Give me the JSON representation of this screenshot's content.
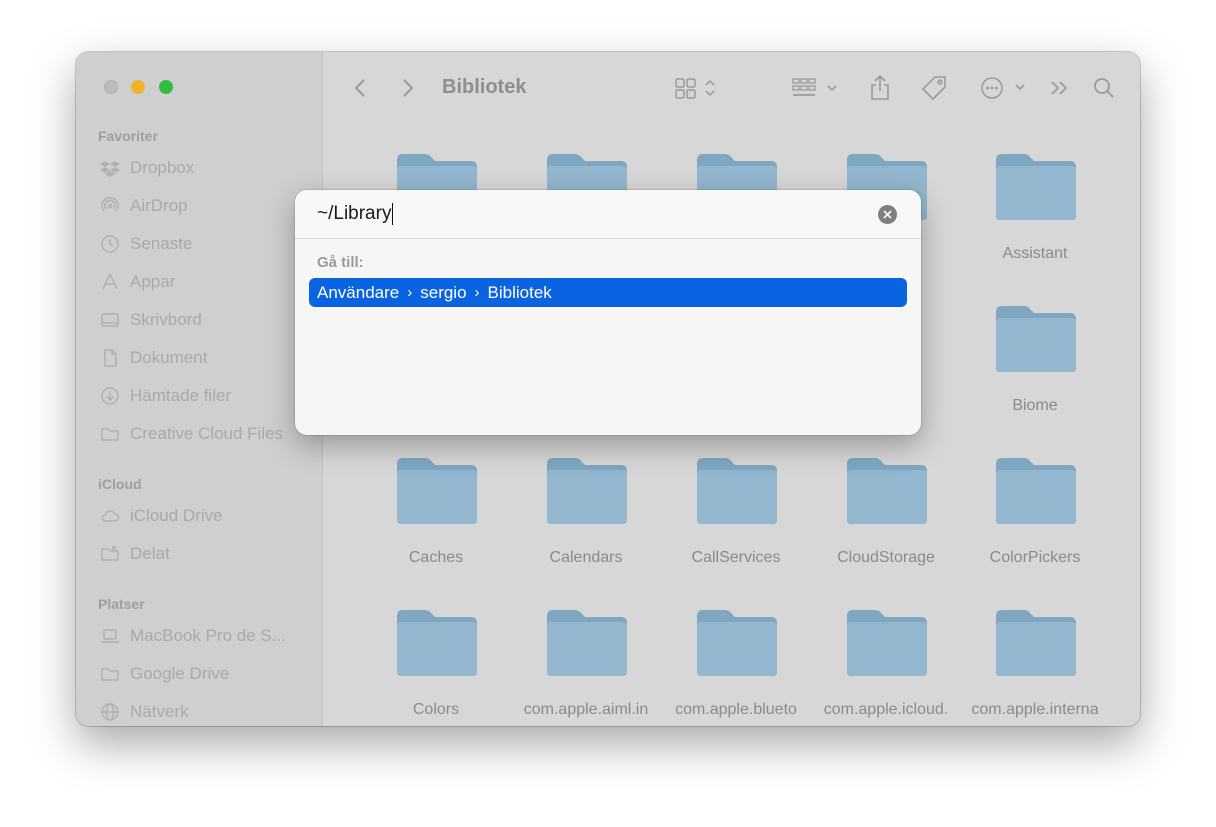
{
  "window": {
    "title": "Bibliotek"
  },
  "sidebar": {
    "sections": [
      {
        "title": "Favoriter",
        "items": [
          {
            "label": "Dropbox",
            "icon": "dropbox-icon"
          },
          {
            "label": "AirDrop",
            "icon": "airdrop-icon"
          },
          {
            "label": "Senaste",
            "icon": "clock-icon"
          },
          {
            "label": "Appar",
            "icon": "apps-icon"
          },
          {
            "label": "Skrivbord",
            "icon": "desktop-icon"
          },
          {
            "label": "Dokument",
            "icon": "document-icon"
          },
          {
            "label": "Hämtade filer",
            "icon": "download-icon"
          },
          {
            "label": "Creative Cloud Files",
            "icon": "folder-icon"
          }
        ]
      },
      {
        "title": "iCloud",
        "items": [
          {
            "label": "iCloud Drive",
            "icon": "cloud-icon"
          },
          {
            "label": "Delat",
            "icon": "shared-folder-icon"
          }
        ]
      },
      {
        "title": "Platser",
        "items": [
          {
            "label": "MacBook Pro de S...",
            "icon": "laptop-icon"
          },
          {
            "label": "Google Drive",
            "icon": "folder-icon"
          },
          {
            "label": "Nätverk",
            "icon": "network-icon"
          }
        ]
      }
    ]
  },
  "folders": [
    {
      "label": ""
    },
    {
      "label": ""
    },
    {
      "label": ""
    },
    {
      "label": ""
    },
    {
      "label": "Assistant"
    },
    {
      "label": "Biome"
    },
    {
      "label": "Caches"
    },
    {
      "label": "Calendars"
    },
    {
      "label": "CallServices"
    },
    {
      "label": "CloudStorage"
    },
    {
      "label": "ColorPickers"
    },
    {
      "label": "Colors"
    },
    {
      "label": "com.apple.aiml.in"
    },
    {
      "label": "com.apple.blueto"
    },
    {
      "label": "com.apple.icloud."
    },
    {
      "label": "com.apple.interna"
    }
  ],
  "goto_dialog": {
    "input_value": "~/Library",
    "section_label": "Gå till:",
    "path": [
      "Användare",
      "sergio",
      "Bibliotek"
    ],
    "separator": "›"
  },
  "colors": {
    "accent": "#0a63e0",
    "folder": "#8fb4cc"
  }
}
